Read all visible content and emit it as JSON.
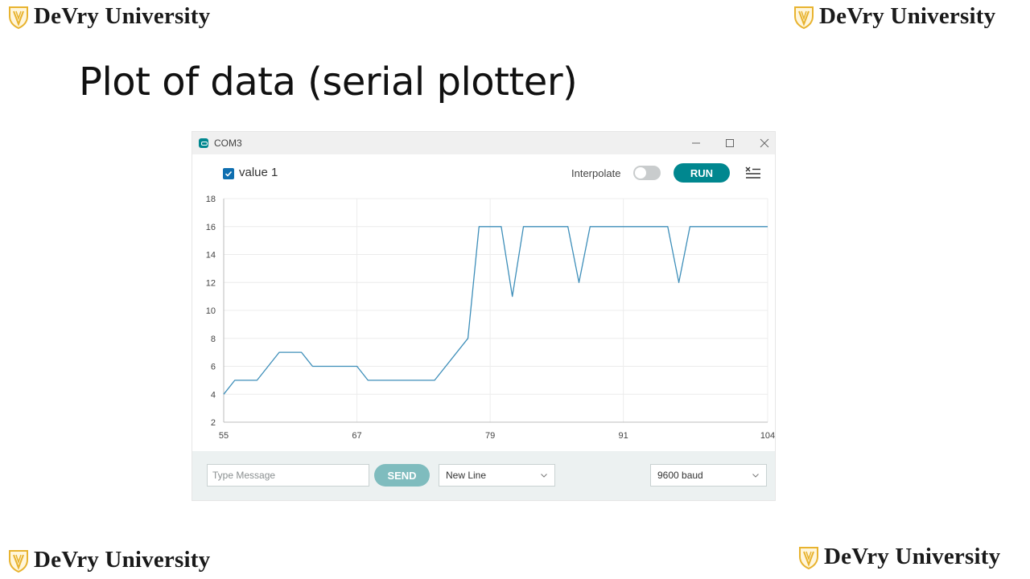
{
  "branding": {
    "text": "DeVry University",
    "accent": "#e8b32f"
  },
  "slide": {
    "title": "Plot of data (serial plotter)"
  },
  "window": {
    "title": "COM3",
    "minimize_icon": "minimize-icon",
    "maximize_icon": "maximize-icon",
    "close_icon": "close-icon"
  },
  "toolbar": {
    "series_checked": true,
    "series_label": "value 1",
    "interpolate_label": "Interpolate",
    "interpolate_on": false,
    "run_label": "RUN",
    "clear_icon": "clear-list-icon",
    "accent": "#00878f"
  },
  "chart_data": {
    "type": "line",
    "title": "",
    "xlabel": "",
    "ylabel": "",
    "xlim": [
      55,
      104
    ],
    "ylim": [
      2,
      18
    ],
    "x_ticks": [
      55,
      67,
      79,
      91,
      104
    ],
    "y_ticks": [
      2,
      4,
      6,
      8,
      10,
      12,
      14,
      16,
      18
    ],
    "grid": true,
    "line_color": "#3d8eb9",
    "series": [
      {
        "name": "value 1",
        "points": [
          [
            55,
            4
          ],
          [
            56,
            5
          ],
          [
            58,
            5
          ],
          [
            60,
            7
          ],
          [
            62,
            7
          ],
          [
            63,
            6
          ],
          [
            67,
            6
          ],
          [
            68,
            5
          ],
          [
            74,
            5
          ],
          [
            77,
            8
          ],
          [
            78,
            16
          ],
          [
            80,
            16
          ],
          [
            81,
            11
          ],
          [
            82,
            16
          ],
          [
            86,
            16
          ],
          [
            87,
            12
          ],
          [
            88,
            16
          ],
          [
            95,
            16
          ],
          [
            96,
            12
          ],
          [
            97,
            16
          ],
          [
            104,
            16
          ]
        ]
      }
    ]
  },
  "footer": {
    "message_placeholder": "Type Message",
    "send_label": "SEND",
    "line_ending": "New Line",
    "baud": "9600 baud"
  }
}
